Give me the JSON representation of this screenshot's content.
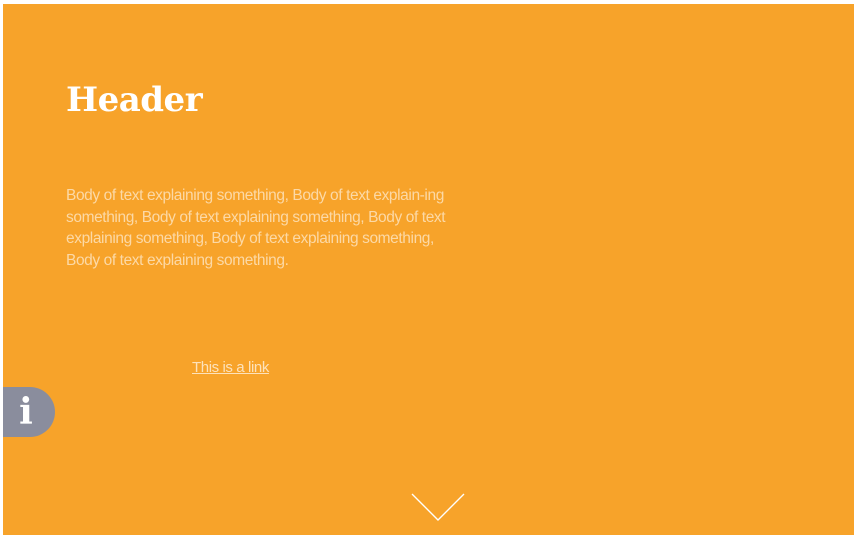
{
  "header": {
    "title": "Header"
  },
  "content": {
    "body": "Body of text explaining something, Body of text explain-ing something, Body of text explaining something, Body of text explaining something, Body of text explaining something, Body of text explaining something.",
    "link_text": "This is a link"
  },
  "info_button": {
    "glyph": "i",
    "icon": "info-icon"
  },
  "scroll_button": {
    "icon": "chevron-down-icon"
  },
  "colors": {
    "background": "#f7a32a",
    "text": "#ffffff",
    "info_button_bg": "#8a8d9d"
  }
}
